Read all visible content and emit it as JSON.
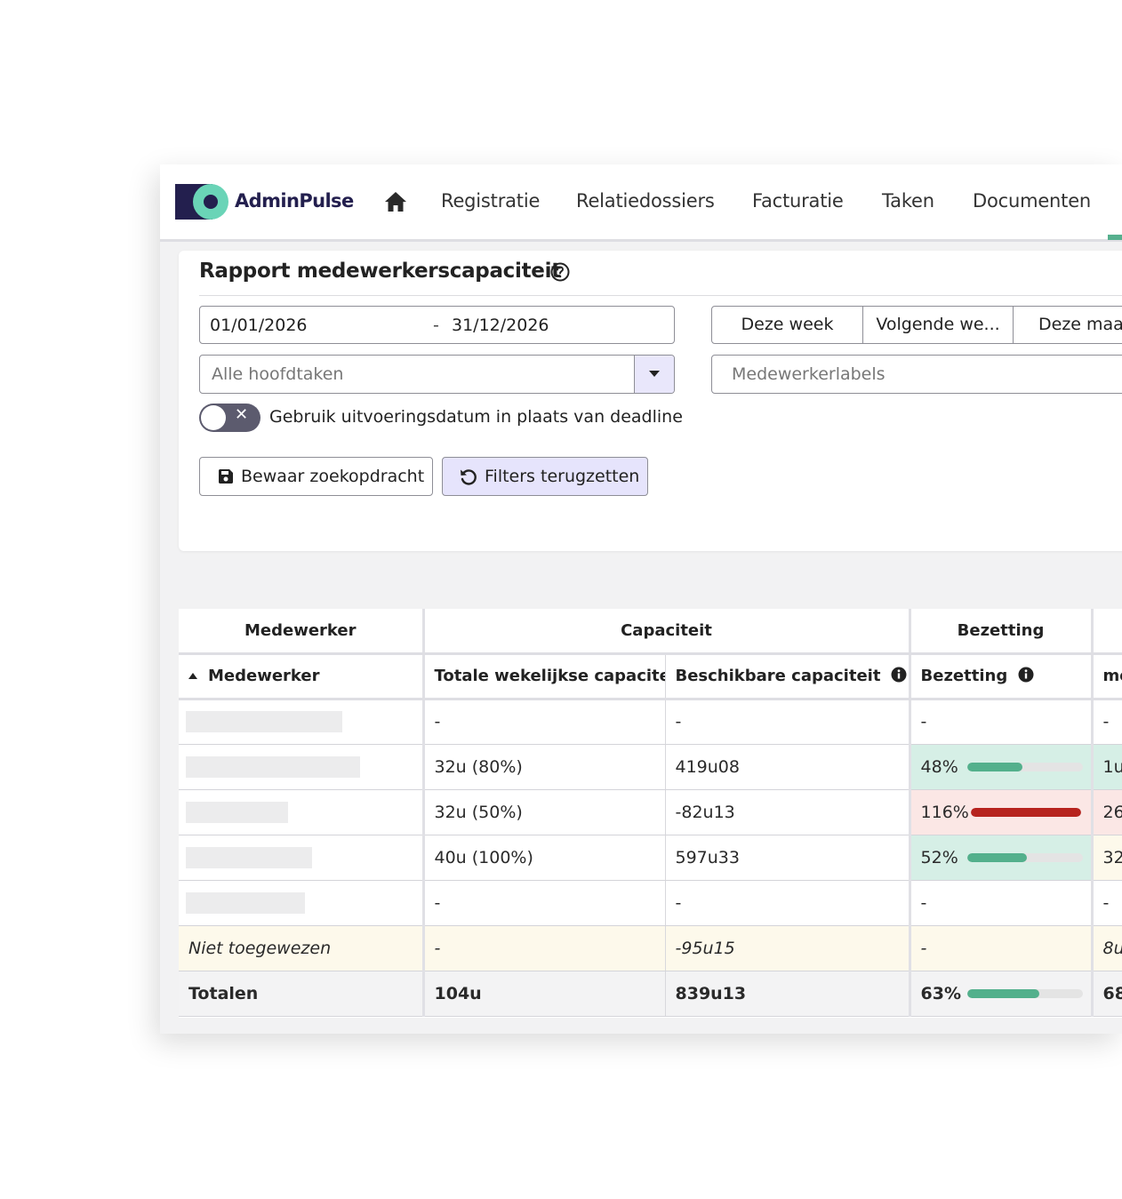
{
  "app": {
    "name": "AdminPulse"
  },
  "nav": {
    "items": [
      "Registratie",
      "Relatiedossiers",
      "Facturatie",
      "Taken",
      "Documenten"
    ]
  },
  "report": {
    "title": "Rapport medewerkerscapaciteit",
    "date_from": "01/01/2026",
    "date_separator": "-",
    "date_to": "31/12/2026",
    "quick_ranges": [
      "Deze week",
      "Volgende we...",
      "Deze maand"
    ],
    "task_select_placeholder": "Alle hoofdtaken",
    "labels_placeholder": "Medewerkerlabels",
    "toggle_label": "Gebruik uitvoeringsdatum in plaats van deadline",
    "toggle_on": false,
    "save_button": "Bewaar zoekopdracht",
    "reset_button": "Filters terugzetten"
  },
  "table": {
    "group_headers": [
      "Medewerker",
      "Capaciteit",
      "Bezetting",
      ""
    ],
    "columns": [
      "Medewerker",
      "Totale wekelijkse capaciteit",
      "Beschikbare capaciteit",
      "Bezetting",
      "me"
    ],
    "rows": [
      {
        "total": "-",
        "available": "-",
        "occupancy_label": "-",
        "occupancy": null,
        "status": "none",
        "extra": "-"
      },
      {
        "total": "32u (80%)",
        "available": "419u08",
        "occupancy_label": "48%",
        "occupancy": 0.48,
        "status": "ok",
        "extra": "1u"
      },
      {
        "total": "32u (50%)",
        "available": "-82u13",
        "occupancy_label": "116%",
        "occupancy": 1.16,
        "status": "over",
        "extra": "26"
      },
      {
        "total": "40u (100%)",
        "available": "597u33",
        "occupancy_label": "52%",
        "occupancy": 0.52,
        "status": "ok",
        "extra": "32"
      },
      {
        "total": "-",
        "available": "-",
        "occupancy_label": "-",
        "occupancy": null,
        "status": "none",
        "extra": "-"
      }
    ],
    "unassigned": {
      "name": "Niet toegewezen",
      "total": "-",
      "available": "-95u15",
      "occupancy_label": "-",
      "extra": "8u"
    },
    "totals": {
      "name": "Totalen",
      "total": "104u",
      "available": "839u13",
      "occupancy_label": "63%",
      "occupancy": 0.63,
      "extra": "68"
    }
  },
  "colors": {
    "brand_dark": "#231f4e",
    "brand_accent": "#6ad4b7",
    "ok": "#53b08c",
    "over": "#b7231e"
  }
}
